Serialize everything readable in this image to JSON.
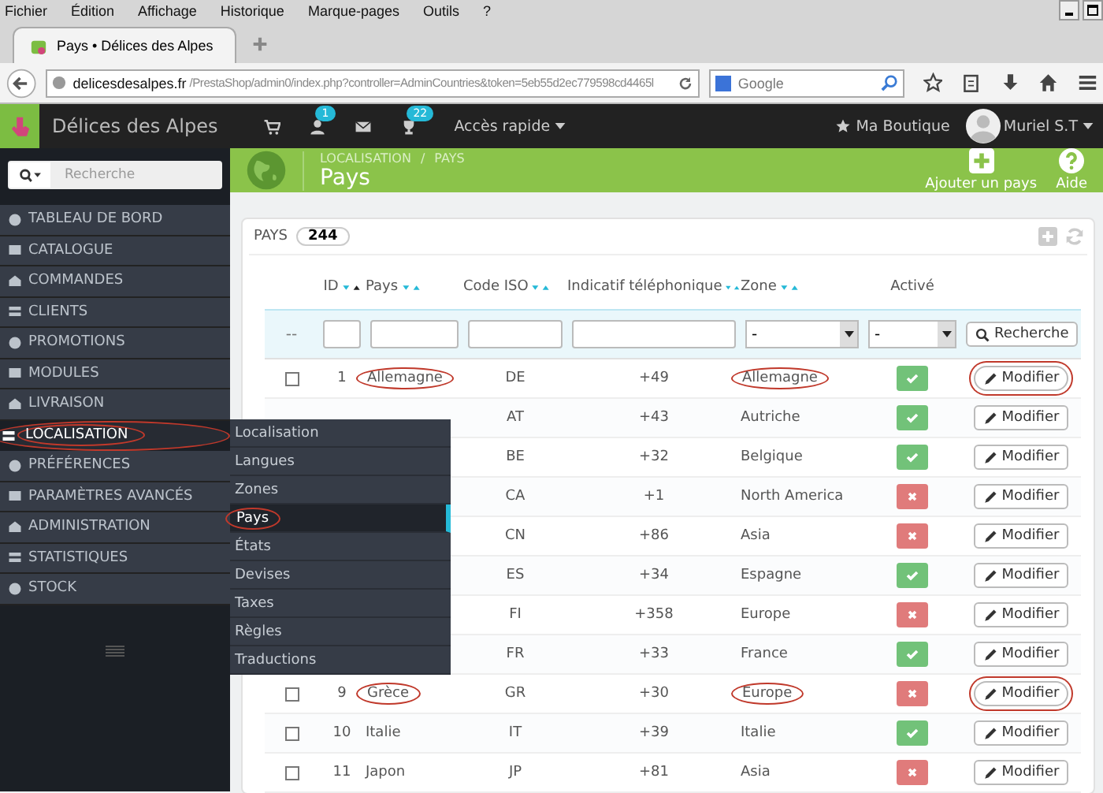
{
  "browser": {
    "menu": [
      "Fichier",
      "Édition",
      "Affichage",
      "Historique",
      "Marque-pages",
      "Outils",
      "?"
    ],
    "tab": {
      "title": "Pays • Délices des Alpes"
    },
    "url": {
      "host": "delicesdesalpes.fr",
      "path": "/PrestaShop/admin0/index.php?controller=AdminCountries&token=5eb55d2ec779598cd4465l"
    },
    "search": {
      "placeholder": "Google"
    }
  },
  "topbar": {
    "shop": "Délices des Alpes",
    "customers_badge": "1",
    "trophy_badge": "22",
    "quick_access": "Accès rapide",
    "my_shop": "Ma Boutique",
    "user": "Muriel S.T"
  },
  "sidebar": {
    "search": {
      "placeholder": "Recherche"
    },
    "items": [
      {
        "label": "TABLEAU DE BORD",
        "selected": false
      },
      {
        "label": "CATALOGUE",
        "selected": false
      },
      {
        "label": "COMMANDES",
        "selected": false
      },
      {
        "label": "CLIENTS",
        "selected": false
      },
      {
        "label": "PROMOTIONS",
        "selected": false
      },
      {
        "label": "MODULES",
        "selected": false
      },
      {
        "label": "LIVRAISON",
        "selected": false
      },
      {
        "label": "LOCALISATION",
        "selected": true,
        "circled": true
      },
      {
        "label": "PRÉFÉRENCES",
        "selected": false
      },
      {
        "label": "PARAMÈTRES AVANCÉS",
        "selected": false
      },
      {
        "label": "ADMINISTRATION",
        "selected": false
      },
      {
        "label": "STATISTIQUES",
        "selected": false
      },
      {
        "label": "STOCK",
        "selected": false
      }
    ],
    "submenu": [
      {
        "label": "Localisation",
        "selected": false,
        "circled": false
      },
      {
        "label": "Langues",
        "selected": false,
        "circled": false
      },
      {
        "label": "Zones",
        "selected": false,
        "circled": false
      },
      {
        "label": "Pays",
        "selected": true,
        "circled": true
      },
      {
        "label": "États",
        "selected": false,
        "circled": false
      },
      {
        "label": "Devises",
        "selected": false,
        "circled": false
      },
      {
        "label": "Taxes",
        "selected": false,
        "circled": false
      },
      {
        "label": "Règles",
        "selected": false,
        "circled": false
      },
      {
        "label": "Traductions",
        "selected": false,
        "circled": false
      }
    ]
  },
  "header": {
    "breadcrumb": [
      "LOCALISATION",
      "PAYS"
    ],
    "breadcrumb_separator": "/",
    "title": "Pays",
    "add_label": "Ajouter un pays",
    "help_label": "Aide"
  },
  "panel": {
    "title": "PAYS",
    "count": "244"
  },
  "table": {
    "columns": [
      {
        "label": "ID",
        "sortable": true
      },
      {
        "label": "Pays",
        "sortable": true
      },
      {
        "label": "Code ISO",
        "sortable": true
      },
      {
        "label": "Indicatif téléphonique",
        "sortable": true
      },
      {
        "label": "Zone",
        "sortable": true
      },
      {
        "label": "Activé",
        "sortable": false
      }
    ],
    "filter": {
      "reset": "--",
      "zone_select": "-",
      "active_select": "-",
      "search_button": "Recherche"
    },
    "rows": [
      {
        "checked": false,
        "id": "1",
        "name": "Allemagne",
        "iso": "DE",
        "phone": "+49",
        "zone": "Allemagne",
        "active": true,
        "action": "Modifier",
        "name_circled": true,
        "zone_circled": true,
        "action_circled": true
      },
      {
        "iso": "AT",
        "phone": "+43",
        "zone": "Autriche",
        "active": true,
        "action": "Modifier",
        "zone_circled": false,
        "action_circled": false
      },
      {
        "iso": "BE",
        "phone": "+32",
        "zone": "Belgique",
        "active": true,
        "action": "Modifier",
        "zone_circled": false,
        "action_circled": false
      },
      {
        "iso": "CA",
        "phone": "+1",
        "zone": "North America",
        "active": false,
        "action": "Modifier",
        "zone_circled": false,
        "action_circled": false
      },
      {
        "iso": "CN",
        "phone": "+86",
        "zone": "Asia",
        "active": false,
        "action": "Modifier",
        "zone_circled": false,
        "action_circled": false
      },
      {
        "iso": "ES",
        "phone": "+34",
        "zone": "Espagne",
        "active": true,
        "action": "Modifier",
        "zone_circled": false,
        "action_circled": false
      },
      {
        "iso": "FI",
        "phone": "+358",
        "zone": "Europe",
        "active": false,
        "action": "Modifier",
        "zone_circled": false,
        "action_circled": false
      },
      {
        "iso": "FR",
        "phone": "+33",
        "zone": "France",
        "active": true,
        "action": "Modifier",
        "zone_circled": false,
        "action_circled": false
      },
      {
        "checked": false,
        "id": "9",
        "name": "Grèce",
        "iso": "GR",
        "phone": "+30",
        "zone": "Europe",
        "active": false,
        "action": "Modifier",
        "name_circled": true,
        "zone_circled": true,
        "action_circled": true
      },
      {
        "checked": false,
        "id": "10",
        "name": "Italie",
        "iso": "IT",
        "phone": "+39",
        "zone": "Italie",
        "active": true,
        "action": "Modifier",
        "name_circled": false,
        "zone_circled": false,
        "action_circled": false
      },
      {
        "checked": false,
        "id": "11",
        "name": "Japon",
        "iso": "JP",
        "phone": "+81",
        "zone": "Asia",
        "active": false,
        "action": "Modifier",
        "name_circled": false,
        "zone_circled": false,
        "action_circled": false
      }
    ]
  }
}
